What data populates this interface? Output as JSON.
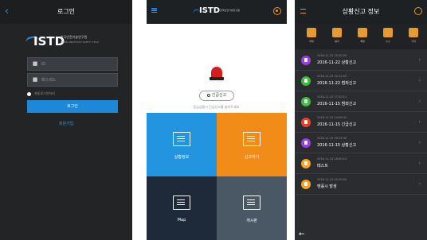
{
  "login": {
    "back_icon": "back-arrow-icon",
    "title": "로그인",
    "logo_text": "ISTD",
    "logo_sub": "한국안전기술연구원",
    "logo_sub2": "KOREA INSTITUTE SAFETY TECH",
    "id_placeholder": "ID",
    "pw_placeholder": "패스워드",
    "auto_login_label": "자동로그인하기",
    "login_button": "로그인",
    "join_link": "회원가입"
  },
  "main": {
    "logo_text": "ISTD",
    "logo_sub": "한국안전기술연구원",
    "emergency_button": "긴급신고",
    "emergency_desc": "응급상황시 긴급신고를 눌러주세요.",
    "tiles": [
      {
        "label": "상황정보",
        "icon": "monitor-icon",
        "color": "#2395e0"
      },
      {
        "label": "신고하기",
        "icon": "message-icon",
        "color": "#f28c18"
      },
      {
        "label": "Map",
        "icon": "map-icon",
        "color": "#1e2a3a"
      },
      {
        "label": "게시판",
        "icon": "board-icon",
        "color": "#4a5866"
      }
    ]
  },
  "status": {
    "title": "상황신고 정보",
    "categories": [
      {
        "label": "화재",
        "icon": "fire-icon"
      },
      {
        "label": "붕괴",
        "icon": "collapse-icon"
      },
      {
        "label": "폭발",
        "icon": "explosion-icon"
      },
      {
        "label": "누출",
        "icon": "leak-icon"
      },
      {
        "label": "기타",
        "icon": "etc-icon"
      }
    ],
    "rows": [
      {
        "time": "2016-11-22 10:30:20",
        "text": "2016-11-22 상황신고",
        "color": "#9b3fd8"
      },
      {
        "time": "2016-11-22 10:12:05",
        "text": "2016-11-22 범죄신고",
        "color": "#3fb83f"
      },
      {
        "time": "2016-11-15 17:20:11",
        "text": "2016-11-15 범죄신고",
        "color": "#3fb83f"
      },
      {
        "time": "2016-11-15 14:06:32",
        "text": "2016-11-15 긴급신고",
        "color": "#e2432b"
      },
      {
        "time": "2016-11-15 09:25:40",
        "text": "2016-11-15 상황신고",
        "color": "#9b3fd8"
      },
      {
        "time": "2016-11-14 18:40:15",
        "text": "테스트",
        "color": "#f0a52b"
      },
      {
        "time": "2016-11-14 15:30:02",
        "text": "맨홀시 발생",
        "color": "#f0a52b"
      }
    ]
  }
}
